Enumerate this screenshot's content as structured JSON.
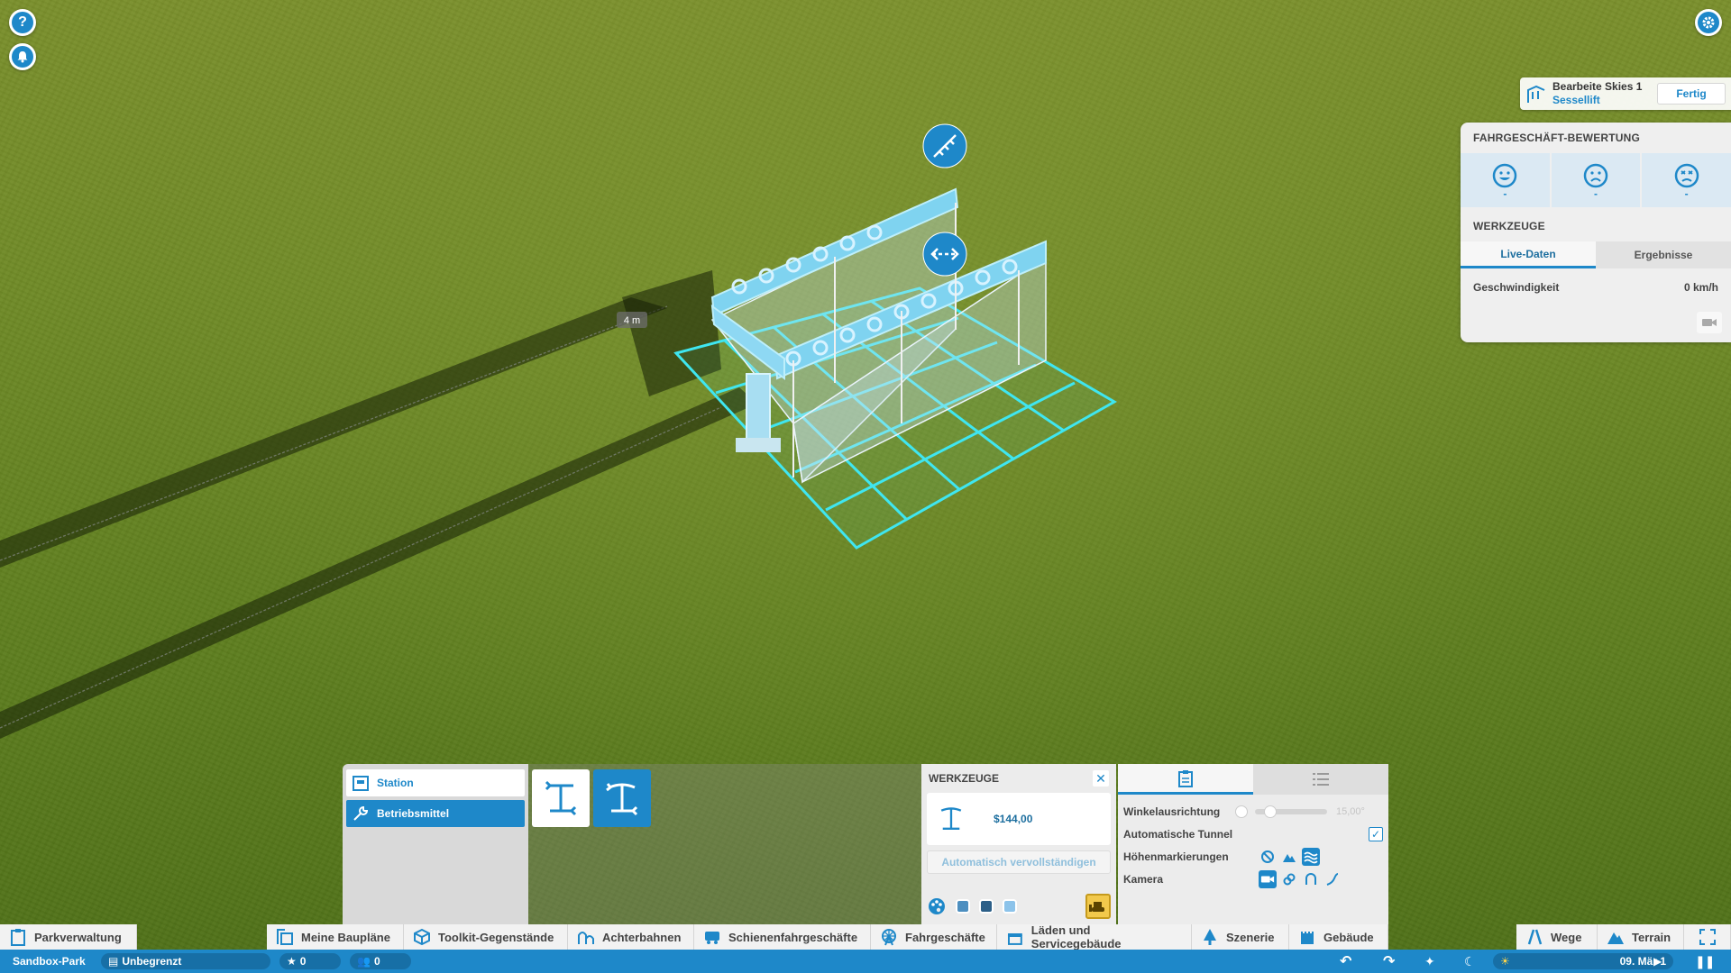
{
  "edit_ride": {
    "title": "Bearbeite Skies 1",
    "subtitle": "Sessellift",
    "done_label": "Fertig"
  },
  "rating_panel": {
    "title": "FAHRGESCHÄFT-BEWERTUNG",
    "ratings": [
      {
        "icon": "happy-face-icon",
        "value": "-"
      },
      {
        "icon": "neutral-face-icon",
        "value": "-"
      },
      {
        "icon": "sick-face-icon",
        "value": "-"
      }
    ],
    "tools_title": "WERKZEUGE",
    "tabs": [
      "Live-Daten",
      "Ergebnisse"
    ],
    "speed_label": "Geschwindigkeit",
    "speed_value": "0 km/h"
  },
  "scene": {
    "distance_label": "4 m"
  },
  "build_panel": {
    "items": [
      {
        "label": "Station",
        "active": false
      },
      {
        "label": "Betriebsmittel",
        "active": true
      }
    ],
    "tools_title": "WERKZEUGE",
    "price": "$144,00",
    "autocomplete_label": "Automatisch vervollständigen",
    "swatches": [
      "#4d8fc0",
      "#2c5f88",
      "#8cc3ea"
    ]
  },
  "options_panel": {
    "angle_label": "Winkelausrichtung",
    "angle_value": "15,00°",
    "auto_tunnel_label": "Automatische Tunnel",
    "height_markers_label": "Höhenmarkierungen",
    "camera_label": "Kamera"
  },
  "nav": {
    "park_management": "Parkverwaltung",
    "blueprints": "Meine Baupläne",
    "toolkit": "Toolkit-Gegenstände",
    "coasters": "Achterbahnen",
    "track_rides": "Schienenfahrgeschäfte",
    "rides": "Fahrgeschäfte",
    "shops": "Läden und Servicegebäude",
    "scenery": "Szenerie",
    "buildings": "Gebäude",
    "paths": "Wege",
    "terrain": "Terrain"
  },
  "status": {
    "park_name": "Sandbox-Park",
    "money": "Unbegrenzt",
    "rating": "0",
    "guests": "0",
    "date": "09. Mär 1"
  },
  "colors": {
    "accent": "#1e88c9",
    "grid": "#3fe6f0"
  }
}
